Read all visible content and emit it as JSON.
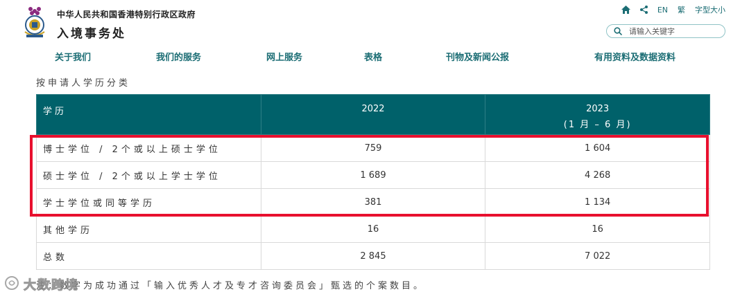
{
  "header": {
    "org_name": "中华人民共和国香港特别行政区政府",
    "dept_name": "入境事务处",
    "tools": {
      "lang": "EN",
      "traditional": "繁",
      "font_size": "字型大小"
    },
    "search_placeholder": "请输入关键字"
  },
  "nav": {
    "items": [
      {
        "label": "关于我们"
      },
      {
        "label": "我们的服务"
      },
      {
        "label": "网上服务"
      },
      {
        "label": "表格"
      },
      {
        "label": "刊物及新闻公报"
      },
      {
        "label": "有用资料及数据资料"
      }
    ]
  },
  "section_title": "按申请人学历分类",
  "table": {
    "headers": {
      "category": "学历",
      "col_2022": "2022",
      "col_2023": "2023",
      "col_2023_sub": "(1 月  – 6 月)"
    },
    "rows": [
      {
        "category": "博士学位 / 2个或以上硕士学位",
        "y2022": "759",
        "y2023": "1 604"
      },
      {
        "category": "硕士学位 / 2个或以上学士学位",
        "y2022": "1 689",
        "y2023": "4 268"
      },
      {
        "category": "学士学位或同等学历",
        "y2022": "381",
        "y2023": "1 134"
      },
      {
        "category": "其他学历",
        "y2022": "16",
        "y2023": "16"
      },
      {
        "category": "总数",
        "y2022": "2 845",
        "y2023": "7 022"
      }
    ]
  },
  "note": "注：数字为成功通过「输入优秀人才及专才咨询委员会」甄选的个案数目。",
  "watermark": "大数跨境",
  "colors": {
    "teal": "#00616a",
    "nav_text": "#1b6d74",
    "highlight": "#e8102e"
  }
}
